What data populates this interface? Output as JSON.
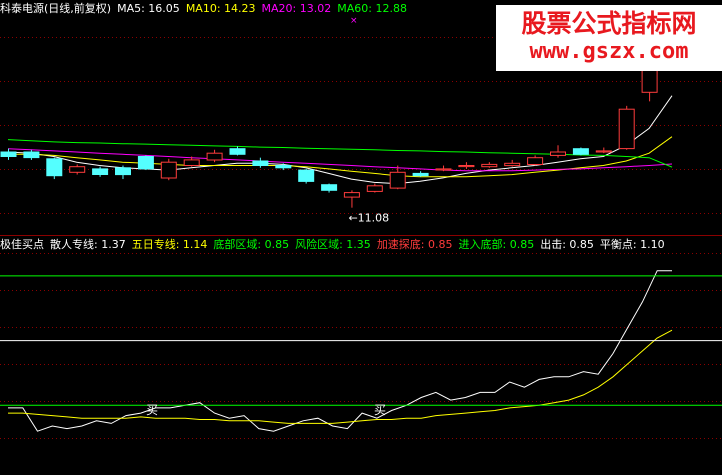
{
  "colors": {
    "background": "#000000",
    "up_candle": "#ff3c3c",
    "down_candle": "#54ffff",
    "ma5": "#ffffff",
    "ma10": "#ffff00",
    "ma20": "#ff00ff",
    "ma60": "#00ff00",
    "scatter_line": "#ffffff",
    "five_day_line": "#ffff00",
    "bottom_zone": "#00ff00",
    "risk_zone": "#00ff00",
    "accelerate_bottom": "#ff3c3c",
    "enter_bottom": "#00ff00",
    "exit": "#ffffff",
    "balance": "#ffffff",
    "watermark": "#e8191f"
  },
  "watermark": {
    "title": "股票公式指标网",
    "url": "www.gszx.com"
  },
  "main_panel": {
    "title": "科泰电源(日线,前复权)",
    "indicators": [
      {
        "label": "MA5: 16.05",
        "color": "#ffffff"
      },
      {
        "label": "MA10: 14.23",
        "color": "#ffff00"
      },
      {
        "label": "MA20: 13.02",
        "color": "#ff00ff"
      },
      {
        "label": "MA60: 12.88",
        "color": "#00ff00"
      }
    ],
    "low_marker": "←11.08",
    "top_marker": "×"
  },
  "sub_panel": {
    "title": "极佳买点",
    "indicators": [
      {
        "label": "散人专线: 1.37",
        "color": "#ffffff"
      },
      {
        "label": "五日专线: 1.14",
        "color": "#ffff00"
      },
      {
        "label": "底部区域: 0.85",
        "color": "#00ff00"
      },
      {
        "label": "风险区域: 1.35",
        "color": "#00ff00"
      },
      {
        "label": "加速探底: 0.85",
        "color": "#ff3c3c"
      },
      {
        "label": "进入底部: 0.85",
        "color": "#00ff00"
      },
      {
        "label": "出击: 0.85",
        "color": "#ffffff"
      },
      {
        "label": "平衡点: 1.10",
        "color": "#ffffff"
      }
    ],
    "buy_marker": "买"
  },
  "chart_data": [
    {
      "type": "candlestick",
      "title": "科泰电源(日线,前复权)",
      "ylim": [
        10.0,
        19.5
      ],
      "candles": [
        {
          "o": 13.55,
          "c": 13.35,
          "h": 13.7,
          "l": 13.2
        },
        {
          "o": 13.55,
          "c": 13.3,
          "h": 13.65,
          "l": 13.2
        },
        {
          "o": 13.25,
          "c": 12.5,
          "h": 13.3,
          "l": 12.35
        },
        {
          "o": 12.65,
          "c": 12.9,
          "h": 13.0,
          "l": 12.55
        },
        {
          "o": 12.8,
          "c": 12.55,
          "h": 12.9,
          "l": 12.45
        },
        {
          "o": 12.85,
          "c": 12.55,
          "h": 12.95,
          "l": 12.35
        },
        {
          "o": 13.35,
          "c": 12.8,
          "h": 13.4,
          "l": 12.75
        },
        {
          "o": 12.4,
          "c": 13.1,
          "h": 13.25,
          "l": 12.3
        },
        {
          "o": 12.95,
          "c": 13.2,
          "h": 13.35,
          "l": 12.9
        },
        {
          "o": 13.2,
          "c": 13.5,
          "h": 13.65,
          "l": 13.1
        },
        {
          "o": 13.7,
          "c": 13.45,
          "h": 13.8,
          "l": 13.4
        },
        {
          "o": 13.15,
          "c": 12.95,
          "h": 13.3,
          "l": 12.85
        },
        {
          "o": 12.95,
          "c": 12.85,
          "h": 13.05,
          "l": 12.75
        },
        {
          "o": 12.75,
          "c": 12.25,
          "h": 12.8,
          "l": 12.15
        },
        {
          "o": 12.1,
          "c": 11.85,
          "h": 12.15,
          "l": 11.75
        },
        {
          "o": 11.55,
          "c": 11.75,
          "h": 11.85,
          "l": 11.08
        },
        {
          "o": 11.8,
          "c": 12.05,
          "h": 12.15,
          "l": 11.75
        },
        {
          "o": 11.95,
          "c": 12.65,
          "h": 12.95,
          "l": 11.9
        },
        {
          "o": 12.6,
          "c": 12.5,
          "h": 12.7,
          "l": 12.45
        },
        {
          "o": 12.75,
          "c": 12.8,
          "h": 12.95,
          "l": 12.7
        },
        {
          "o": 12.9,
          "c": 12.95,
          "h": 13.1,
          "l": 12.8
        },
        {
          "o": 12.9,
          "c": 13.0,
          "h": 13.1,
          "l": 12.85
        },
        {
          "o": 12.95,
          "c": 13.05,
          "h": 13.2,
          "l": 12.9
        },
        {
          "o": 13.0,
          "c": 13.3,
          "h": 13.4,
          "l": 12.95
        },
        {
          "o": 13.4,
          "c": 13.55,
          "h": 13.85,
          "l": 13.3
        },
        {
          "o": 13.7,
          "c": 13.45,
          "h": 13.75,
          "l": 13.4
        },
        {
          "o": 13.55,
          "c": 13.6,
          "h": 13.75,
          "l": 13.5
        },
        {
          "o": 13.7,
          "c": 15.45,
          "h": 15.6,
          "l": 13.65
        },
        {
          "o": 16.2,
          "c": 17.9,
          "h": 18.0,
          "l": 15.8
        },
        {
          "o": 17.3,
          "c": 19.2,
          "h": 19.4,
          "l": 17.2
        }
      ],
      "series": [
        {
          "name": "MA5",
          "color": "#ffffff",
          "values": [
            13.55,
            13.5,
            13.35,
            13.1,
            12.95,
            12.85,
            12.8,
            12.75,
            12.85,
            12.95,
            13.05,
            13.05,
            13.0,
            12.85,
            12.6,
            12.35,
            12.2,
            12.15,
            12.25,
            12.4,
            12.6,
            12.75,
            12.85,
            12.95,
            13.1,
            13.25,
            13.35,
            13.85,
            14.6,
            16.05
          ]
        },
        {
          "name": "MA10",
          "color": "#ffff00",
          "values": [
            13.45,
            13.45,
            13.4,
            13.3,
            13.2,
            13.1,
            13.05,
            13.0,
            12.95,
            12.95,
            12.95,
            12.95,
            12.95,
            12.9,
            12.8,
            12.7,
            12.6,
            12.5,
            12.45,
            12.45,
            12.45,
            12.5,
            12.55,
            12.65,
            12.75,
            12.85,
            12.95,
            13.15,
            13.5,
            14.23
          ]
        },
        {
          "name": "MA20",
          "color": "#ff00ff",
          "values": [
            13.7,
            13.65,
            13.6,
            13.55,
            13.5,
            13.45,
            13.4,
            13.35,
            13.3,
            13.25,
            13.2,
            13.15,
            13.1,
            13.05,
            13.0,
            12.95,
            12.9,
            12.85,
            12.8,
            12.75,
            12.72,
            12.72,
            12.72,
            12.75,
            12.78,
            12.8,
            12.85,
            12.9,
            12.95,
            13.02
          ]
        },
        {
          "name": "MA60",
          "color": "#00ff00",
          "values": [
            14.1,
            14.05,
            14.0,
            13.97,
            13.95,
            13.92,
            13.9,
            13.87,
            13.85,
            13.82,
            13.8,
            13.77,
            13.75,
            13.72,
            13.7,
            13.67,
            13.65,
            13.62,
            13.6,
            13.57,
            13.55,
            13.52,
            13.5,
            13.47,
            13.45,
            13.42,
            13.4,
            13.35,
            13.3,
            12.88
          ]
        }
      ]
    },
    {
      "type": "line",
      "title": "极佳买点",
      "ylim": [
        0.6,
        1.45
      ],
      "series": [
        {
          "name": "散人专线",
          "color": "#ffffff",
          "values": [
            0.84,
            0.84,
            0.75,
            0.77,
            0.76,
            0.77,
            0.79,
            0.78,
            0.81,
            0.82,
            0.84,
            0.84,
            0.85,
            0.86,
            0.82,
            0.8,
            0.81,
            0.76,
            0.75,
            0.77,
            0.79,
            0.8,
            0.77,
            0.76,
            0.82,
            0.8,
            0.83,
            0.85,
            0.88,
            0.9,
            0.87,
            0.88,
            0.9,
            0.9,
            0.94,
            0.92,
            0.95,
            0.96,
            0.96,
            0.98,
            0.97,
            1.05,
            1.15,
            1.25,
            1.37,
            1.37
          ]
        },
        {
          "name": "五日专线",
          "color": "#ffff00",
          "values": [
            0.82,
            0.82,
            0.815,
            0.81,
            0.805,
            0.8,
            0.8,
            0.8,
            0.8,
            0.805,
            0.8,
            0.8,
            0.8,
            0.795,
            0.795,
            0.79,
            0.79,
            0.79,
            0.785,
            0.78,
            0.78,
            0.78,
            0.78,
            0.785,
            0.79,
            0.795,
            0.795,
            0.8,
            0.8,
            0.81,
            0.815,
            0.82,
            0.825,
            0.83,
            0.84,
            0.845,
            0.85,
            0.86,
            0.87,
            0.89,
            0.92,
            0.96,
            1.01,
            1.06,
            1.11,
            1.14
          ]
        },
        {
          "name": "底部区域",
          "color": "#00ff00",
          "values": [
            0.85,
            0.85
          ]
        },
        {
          "name": "风险区域",
          "color": "#00ff00",
          "values": [
            1.35,
            1.35
          ]
        },
        {
          "name": "平衡点",
          "color": "#ffffff",
          "values": [
            1.1,
            1.1
          ]
        }
      ]
    }
  ]
}
